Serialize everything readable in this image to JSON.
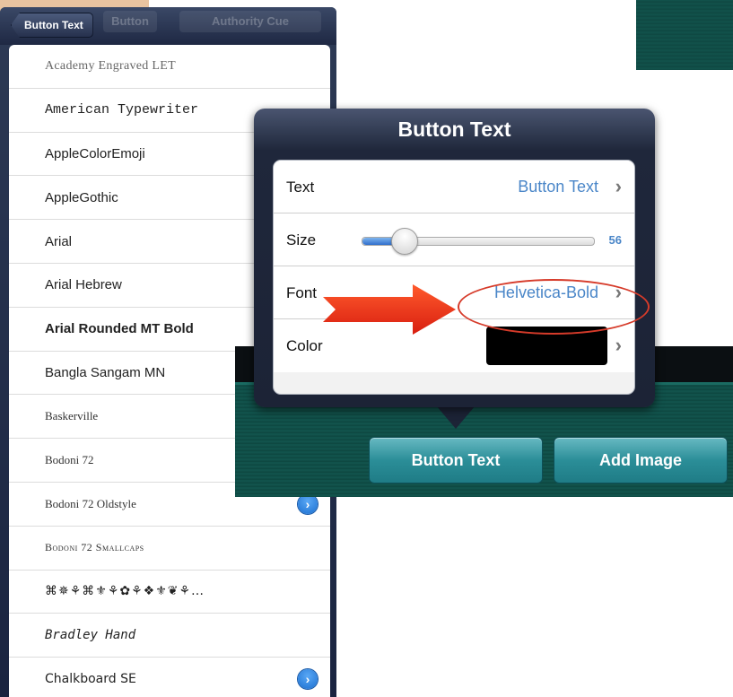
{
  "font_panel": {
    "back_label": "Button Text",
    "ghost_tabs": [
      "Button",
      "Authority Cue"
    ],
    "fonts": [
      {
        "name": "Academy Engraved LET",
        "style": "academy",
        "info": false
      },
      {
        "name": "American Typewriter",
        "style": "typewriter",
        "info": false
      },
      {
        "name": "AppleColorEmoji",
        "style": "sans",
        "info": false
      },
      {
        "name": "AppleGothic",
        "style": "sans",
        "info": false
      },
      {
        "name": "Arial",
        "style": "sans",
        "info": false
      },
      {
        "name": "Arial Hebrew",
        "style": "sans",
        "info": false
      },
      {
        "name": "Arial Rounded MT Bold",
        "style": "bold",
        "info": false
      },
      {
        "name": "Bangla Sangam MN",
        "style": "sans",
        "info": false
      },
      {
        "name": "Baskerville",
        "style": "serif",
        "info": false
      },
      {
        "name": "Bodoni 72",
        "style": "serif",
        "info": false
      },
      {
        "name": "Bodoni 72 Oldstyle",
        "style": "serif",
        "info": true
      },
      {
        "name": "Bodoni 72 Smallcaps",
        "style": "smallcaps",
        "info": false
      },
      {
        "name": "⌘✵⚘⌘⚜⚘✿⚘❖⚜❦⚘…",
        "style": "dingbat",
        "info": false
      },
      {
        "name": "Bradley Hand",
        "style": "hand",
        "info": false
      },
      {
        "name": "Chalkboard SE",
        "style": "chalk",
        "info": true
      }
    ],
    "info_glyph": "›"
  },
  "popover": {
    "title": "Button Text",
    "rows": {
      "text": {
        "label": "Text",
        "value": "Button Text"
      },
      "size": {
        "label": "Size",
        "value": "56",
        "slider_fraction": 0.18
      },
      "font": {
        "label": "Font",
        "value": "Helvetica-Bold"
      },
      "color": {
        "label": "Color",
        "value": "#000000"
      }
    },
    "chevron": "›"
  },
  "toolbar": {
    "button_text_label": "Button Text",
    "add_image_label": "Add Image"
  },
  "colors": {
    "teal": "#13564f",
    "navy": "#1c2336",
    "link_blue": "#4a86c8",
    "annotation_red": "#e8301b"
  }
}
